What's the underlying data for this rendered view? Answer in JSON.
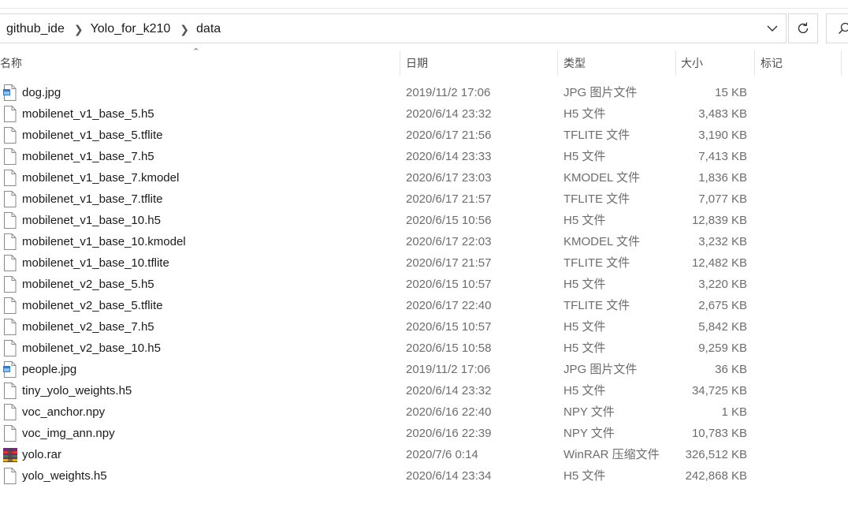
{
  "breadcrumb": [
    "github_ide",
    "Yolo_for_k210",
    "data"
  ],
  "columns": {
    "name": "名称",
    "date": "日期",
    "type": "类型",
    "size": "大小",
    "tags": "标记"
  },
  "files": [
    {
      "name": "dog.jpg",
      "date": "2019/11/2 17:06",
      "type": "JPG 图片文件",
      "size": "15 KB",
      "icon": "image-file-icon"
    },
    {
      "name": "mobilenet_v1_base_5.h5",
      "date": "2020/6/14 23:32",
      "type": "H5 文件",
      "size": "3,483 KB",
      "icon": "generic-file-icon"
    },
    {
      "name": "mobilenet_v1_base_5.tflite",
      "date": "2020/6/17 21:56",
      "type": "TFLITE 文件",
      "size": "3,190 KB",
      "icon": "generic-file-icon"
    },
    {
      "name": "mobilenet_v1_base_7.h5",
      "date": "2020/6/14 23:33",
      "type": "H5 文件",
      "size": "7,413 KB",
      "icon": "generic-file-icon"
    },
    {
      "name": "mobilenet_v1_base_7.kmodel",
      "date": "2020/6/17 23:03",
      "type": "KMODEL 文件",
      "size": "1,836 KB",
      "icon": "generic-file-icon"
    },
    {
      "name": "mobilenet_v1_base_7.tflite",
      "date": "2020/6/17 21:57",
      "type": "TFLITE 文件",
      "size": "7,077 KB",
      "icon": "generic-file-icon"
    },
    {
      "name": "mobilenet_v1_base_10.h5",
      "date": "2020/6/15 10:56",
      "type": "H5 文件",
      "size": "12,839 KB",
      "icon": "generic-file-icon"
    },
    {
      "name": "mobilenet_v1_base_10.kmodel",
      "date": "2020/6/17 22:03",
      "type": "KMODEL 文件",
      "size": "3,232 KB",
      "icon": "generic-file-icon"
    },
    {
      "name": "mobilenet_v1_base_10.tflite",
      "date": "2020/6/17 21:57",
      "type": "TFLITE 文件",
      "size": "12,482 KB",
      "icon": "generic-file-icon"
    },
    {
      "name": "mobilenet_v2_base_5.h5",
      "date": "2020/6/15 10:57",
      "type": "H5 文件",
      "size": "3,220 KB",
      "icon": "generic-file-icon"
    },
    {
      "name": "mobilenet_v2_base_5.tflite",
      "date": "2020/6/17 22:40",
      "type": "TFLITE 文件",
      "size": "2,675 KB",
      "icon": "generic-file-icon"
    },
    {
      "name": "mobilenet_v2_base_7.h5",
      "date": "2020/6/15 10:57",
      "type": "H5 文件",
      "size": "5,842 KB",
      "icon": "generic-file-icon"
    },
    {
      "name": "mobilenet_v2_base_10.h5",
      "date": "2020/6/15 10:58",
      "type": "H5 文件",
      "size": "9,259 KB",
      "icon": "generic-file-icon"
    },
    {
      "name": "people.jpg",
      "date": "2019/11/2 17:06",
      "type": "JPG 图片文件",
      "size": "36 KB",
      "icon": "image-file-icon"
    },
    {
      "name": "tiny_yolo_weights.h5",
      "date": "2020/6/14 23:32",
      "type": "H5 文件",
      "size": "34,725 KB",
      "icon": "generic-file-icon"
    },
    {
      "name": "voc_anchor.npy",
      "date": "2020/6/16 22:40",
      "type": "NPY 文件",
      "size": "1 KB",
      "icon": "generic-file-icon"
    },
    {
      "name": "voc_img_ann.npy",
      "date": "2020/6/16 22:39",
      "type": "NPY 文件",
      "size": "10,783 KB",
      "icon": "generic-file-icon"
    },
    {
      "name": "yolo.rar",
      "date": "2020/7/6 0:14",
      "type": "WinRAR 压缩文件",
      "size": "326,512 KB",
      "icon": "winrar-archive-icon"
    },
    {
      "name": "yolo_weights.h5",
      "date": "2020/6/14 23:34",
      "type": "H5 文件",
      "size": "242,868 KB",
      "icon": "generic-file-icon"
    }
  ]
}
